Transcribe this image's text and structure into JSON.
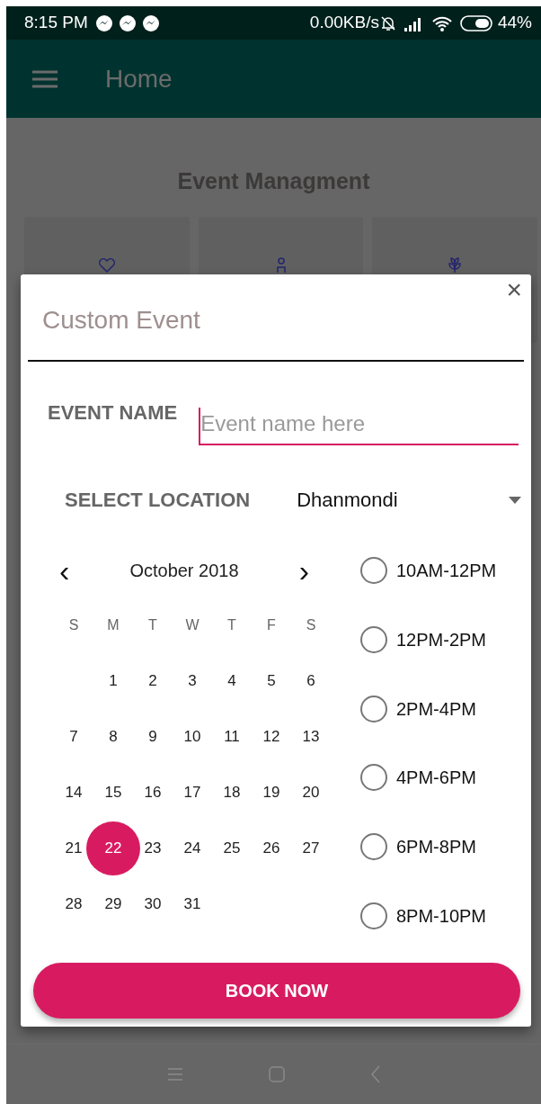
{
  "status_bar": {
    "time": "8:15 PM",
    "network_speed": "0.00KB/s",
    "battery": "44%"
  },
  "app_bar": {
    "title": "Home"
  },
  "page": {
    "heading": "Event Managment",
    "cards": [
      {
        "kind": "heart"
      },
      {
        "kind": "person"
      },
      {
        "kind": "plant"
      }
    ]
  },
  "dialog": {
    "title": "Custom Event",
    "close": "×",
    "event_name": {
      "label": "EVENT NAME",
      "placeholder": "Event name here"
    },
    "location": {
      "label": "SELECT LOCATION",
      "value": "Dhanmondi"
    },
    "calendar": {
      "month": "October 2018",
      "prev": "‹",
      "next": "›",
      "weekdays": [
        "S",
        "M",
        "T",
        "W",
        "T",
        "F",
        "S"
      ],
      "weeks": [
        [
          {
            "day": "1",
            "selected": false
          },
          {
            "day": "2",
            "selected": false
          },
          {
            "day": "3",
            "selected": false
          },
          {
            "day": "4",
            "selected": false
          },
          {
            "day": "5",
            "selected": false
          },
          {
            "day": "6",
            "selected": false
          }
        ],
        [
          {
            "day": "7",
            "selected": false
          },
          {
            "day": "8",
            "selected": false
          },
          {
            "day": "9",
            "selected": false
          },
          {
            "day": "10",
            "selected": false
          },
          {
            "day": "11",
            "selected": false
          },
          {
            "day": "12",
            "selected": false
          },
          {
            "day": "13",
            "selected": false
          }
        ],
        [
          {
            "day": "14",
            "selected": false
          },
          {
            "day": "15",
            "selected": false
          },
          {
            "day": "16",
            "selected": false
          },
          {
            "day": "17",
            "selected": false
          },
          {
            "day": "18",
            "selected": false
          },
          {
            "day": "19",
            "selected": false
          },
          {
            "day": "20",
            "selected": false
          }
        ],
        [
          {
            "day": "21",
            "selected": false
          },
          {
            "day": "22",
            "selected": true
          },
          {
            "day": "23",
            "selected": false
          },
          {
            "day": "24",
            "selected": false
          },
          {
            "day": "25",
            "selected": false
          },
          {
            "day": "26",
            "selected": false
          },
          {
            "day": "27",
            "selected": false
          }
        ],
        [
          {
            "day": "28",
            "selected": false
          },
          {
            "day": "29",
            "selected": false
          },
          {
            "day": "30",
            "selected": false
          },
          {
            "day": "31",
            "selected": false
          }
        ]
      ]
    },
    "time_slots": [
      {
        "label": "10AM-12PM",
        "selected": false
      },
      {
        "label": "12PM-2PM",
        "selected": false
      },
      {
        "label": "2PM-4PM",
        "selected": false
      },
      {
        "label": "4PM-6PM",
        "selected": false
      },
      {
        "label": "6PM-8PM",
        "selected": false
      },
      {
        "label": "8PM-10PM",
        "selected": false
      }
    ],
    "book_button": "BOOK NOW"
  }
}
